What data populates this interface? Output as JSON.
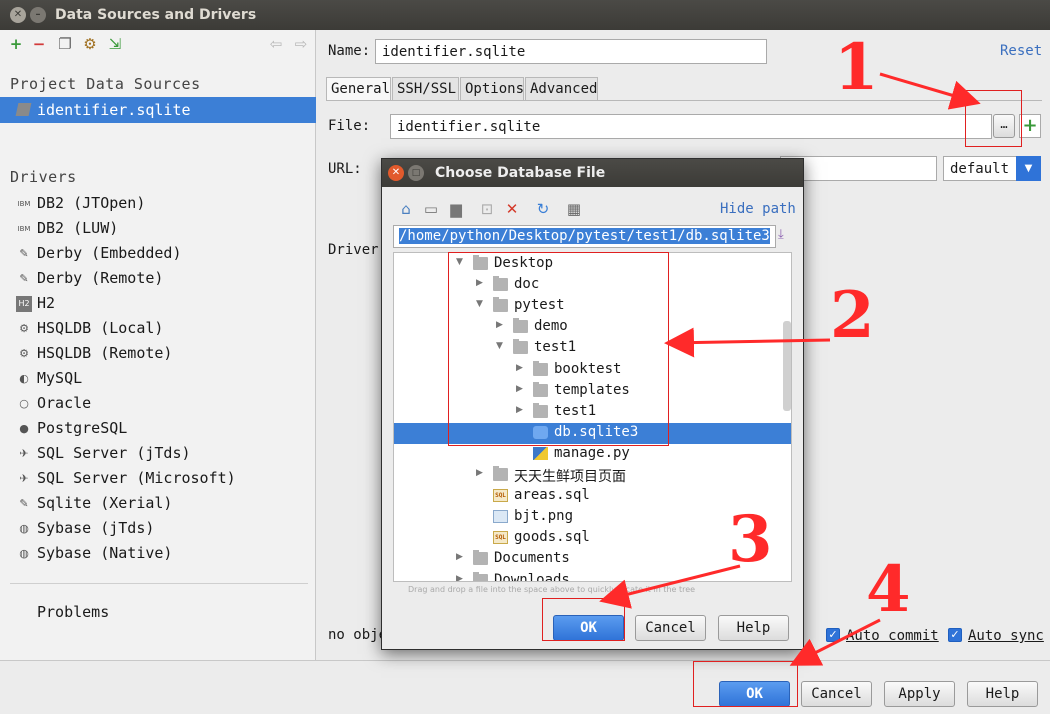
{
  "window": {
    "title": "Data Sources and Drivers"
  },
  "left": {
    "project_heading": "Project Data Sources",
    "data_source": "identifier.sqlite",
    "drivers_heading": "Drivers",
    "drivers": [
      {
        "label": "DB2 (JTOpen)",
        "icon": "IBM"
      },
      {
        "label": "DB2 (LUW)",
        "icon": "IBM"
      },
      {
        "label": "Derby (Embedded)",
        "icon": "feather"
      },
      {
        "label": "Derby (Remote)",
        "icon": "feather"
      },
      {
        "label": "H2",
        "icon": "H2"
      },
      {
        "label": "HSQLDB (Local)",
        "icon": "gear"
      },
      {
        "label": "HSQLDB (Remote)",
        "icon": "gear"
      },
      {
        "label": "MySQL",
        "icon": "dolphin"
      },
      {
        "label": "Oracle",
        "icon": "ring"
      },
      {
        "label": "PostgreSQL",
        "icon": "elephant"
      },
      {
        "label": "SQL Server (jTds)",
        "icon": "sqlserver"
      },
      {
        "label": "SQL Server (Microsoft)",
        "icon": "sqlserver"
      },
      {
        "label": "Sqlite (Xerial)",
        "icon": "feather"
      },
      {
        "label": "Sybase (jTds)",
        "icon": "sybase"
      },
      {
        "label": "Sybase (Native)",
        "icon": "sybase"
      }
    ],
    "problems": "Problems"
  },
  "right": {
    "name_label": "Name:",
    "name_value": "identifier.sqlite",
    "reset": "Reset",
    "tabs": [
      "General",
      "SSH/SSL",
      "Options",
      "Advanced"
    ],
    "file_label": "File:",
    "file_value": "identifier.sqlite",
    "url_label": "URL:",
    "url_mode": "default",
    "driver_label": "Driver",
    "no_obj": "no obje",
    "auto_commit": "Auto commit",
    "auto_sync": "Auto sync"
  },
  "dialog": {
    "title": "Choose Database File",
    "hide_path": "Hide path",
    "path": "/home/python/Desktop/pytest/test1/db.sqlite3",
    "hint": "Drag and drop a file into the space above to quickly locate it in the tree",
    "tree": [
      {
        "label": "Desktop",
        "depth": 0,
        "arrow": "down",
        "kind": "folder"
      },
      {
        "label": "doc",
        "depth": 1,
        "arrow": "right",
        "kind": "folder"
      },
      {
        "label": "pytest",
        "depth": 1,
        "arrow": "down",
        "kind": "folder"
      },
      {
        "label": "demo",
        "depth": 2,
        "arrow": "right",
        "kind": "folder"
      },
      {
        "label": "test1",
        "depth": 2,
        "arrow": "down",
        "kind": "folder"
      },
      {
        "label": "booktest",
        "depth": 3,
        "arrow": "right",
        "kind": "folder"
      },
      {
        "label": "templates",
        "depth": 3,
        "arrow": "right",
        "kind": "folder"
      },
      {
        "label": "test1",
        "depth": 3,
        "arrow": "right",
        "kind": "folder"
      },
      {
        "label": "db.sqlite3",
        "depth": 3,
        "arrow": "",
        "kind": "db",
        "selected": true
      },
      {
        "label": "manage.py",
        "depth": 3,
        "arrow": "",
        "kind": "py"
      },
      {
        "label": "天天生鲜项目页面",
        "depth": 1,
        "arrow": "right",
        "kind": "folder"
      },
      {
        "label": "areas.sql",
        "depth": 1,
        "arrow": "",
        "kind": "sql"
      },
      {
        "label": "bjt.png",
        "depth": 1,
        "arrow": "",
        "kind": "png"
      },
      {
        "label": "goods.sql",
        "depth": 1,
        "arrow": "",
        "kind": "sql"
      },
      {
        "label": "Documents",
        "depth": 0,
        "arrow": "right",
        "kind": "folder"
      },
      {
        "label": "Downloads",
        "depth": 0,
        "arrow": "right",
        "kind": "folder"
      }
    ],
    "ok": "OK",
    "cancel": "Cancel",
    "help": "Help"
  },
  "footer": {
    "ok": "OK",
    "cancel": "Cancel",
    "apply": "Apply",
    "help": "Help"
  },
  "annotations": [
    "1",
    "2",
    "3",
    "4"
  ],
  "colors": {
    "selection": "#3c7fd6",
    "annotation": "#ff2a2a",
    "add": "#3a9a3a"
  }
}
